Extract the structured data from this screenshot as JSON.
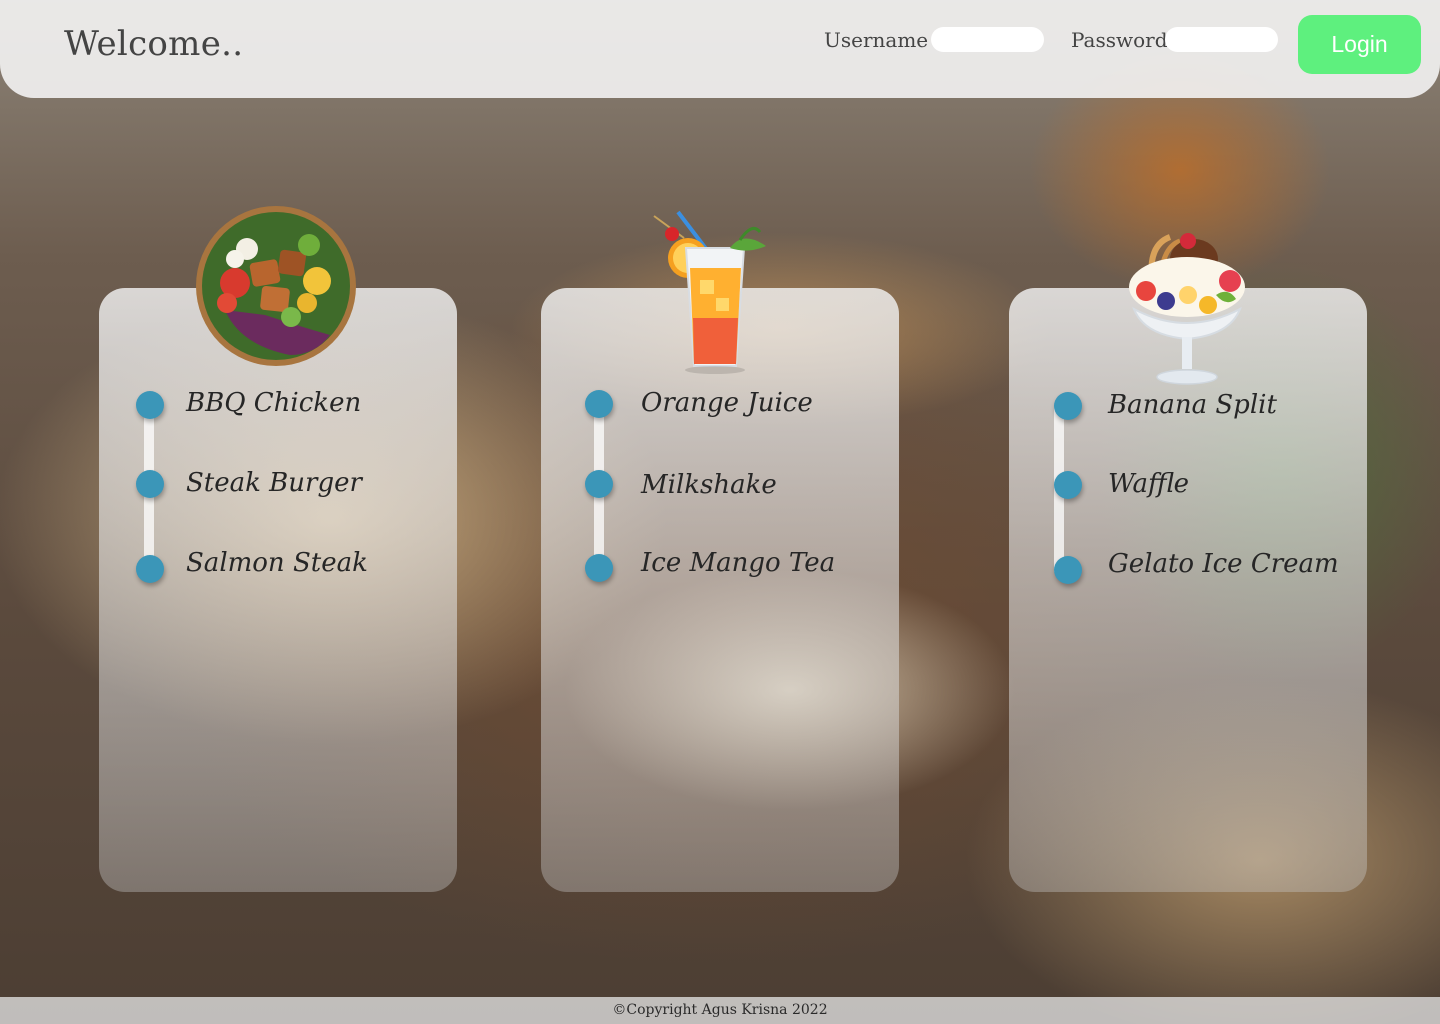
{
  "header": {
    "welcome": "Welcome..",
    "username_label": "Username",
    "password_label": "Password",
    "username_value": "",
    "password_value": "",
    "login_label": "Login"
  },
  "menus": [
    {
      "icon": "salad-bowl-icon",
      "items": [
        "BBQ Chicken",
        "Steak Burger",
        "Salmon Steak"
      ]
    },
    {
      "icon": "orange-juice-icon",
      "items": [
        "Orange Juice",
        "Milkshake",
        "Ice Mango Tea"
      ]
    },
    {
      "icon": "sundae-icon",
      "items": [
        "Banana Split",
        "Waffle",
        "Gelato Ice Cream"
      ]
    }
  ],
  "footer": {
    "copyright": "©Copyright Agus Krisna 2022"
  },
  "colors": {
    "accent": "#3b96b8",
    "login": "#5ef07e",
    "header_bg": "#f6f6f6"
  }
}
